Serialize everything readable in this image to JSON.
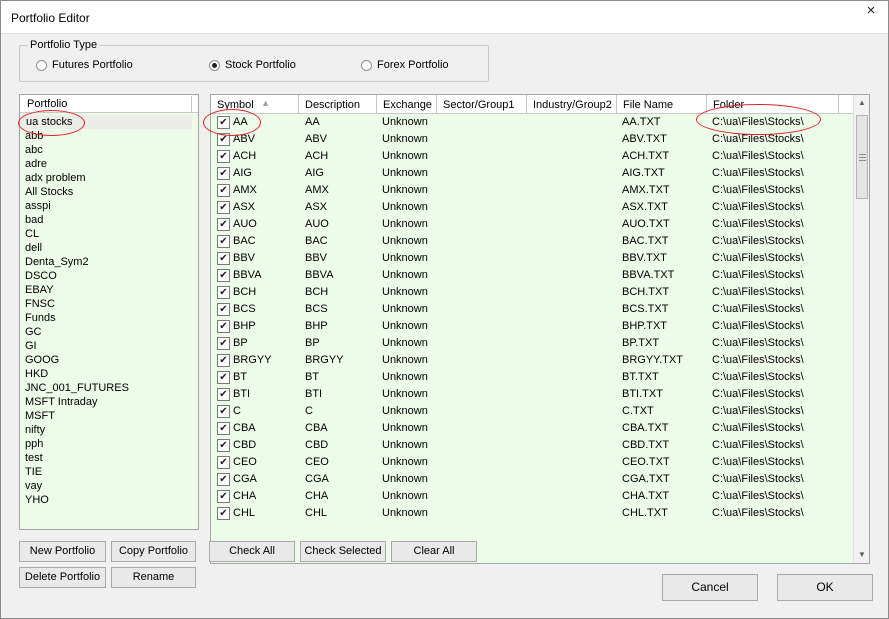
{
  "window": {
    "title": "Portfolio Editor",
    "close_glyph": "×"
  },
  "portfolio_type": {
    "label": "Portfolio Type",
    "options": [
      {
        "label": "Futures Portfolio",
        "checked": false
      },
      {
        "label": "Stock Portfolio",
        "checked": true
      },
      {
        "label": "Forex Portfolio",
        "checked": false
      }
    ]
  },
  "portfolio_list": {
    "header": "Portfolio",
    "items": [
      "ua stocks",
      "abb",
      "abc",
      "adre",
      "adx problem",
      "All Stocks",
      "asspi",
      "bad",
      "CL",
      "dell",
      "Denta_Sym2",
      "DSCO",
      "EBAY",
      "FNSC",
      "Funds",
      "GC",
      "GI",
      "GOOG",
      "HKD",
      "JNC_001_FUTURES",
      "MSFT Intraday",
      "MSFT",
      "nifty",
      "pph",
      "test",
      "TIE",
      "vay",
      "YHO"
    ],
    "selected_index": 0
  },
  "grid": {
    "columns": [
      "Symbol",
      "Description",
      "Exchange",
      "Sector/Group1",
      "Industry/Group2",
      "File Name",
      "Folder"
    ],
    "sort_glyph": "▲",
    "check_glyph": "✔",
    "rows": [
      {
        "symbol": "AA",
        "description": "AA",
        "exchange": "Unknown",
        "sector": "",
        "industry": "",
        "file": "AA.TXT",
        "folder": "C:\\ua\\Files\\Stocks\\"
      },
      {
        "symbol": "ABV",
        "description": "ABV",
        "exchange": "Unknown",
        "sector": "",
        "industry": "",
        "file": "ABV.TXT",
        "folder": "C:\\ua\\Files\\Stocks\\"
      },
      {
        "symbol": "ACH",
        "description": "ACH",
        "exchange": "Unknown",
        "sector": "",
        "industry": "",
        "file": "ACH.TXT",
        "folder": "C:\\ua\\Files\\Stocks\\"
      },
      {
        "symbol": "AIG",
        "description": "AIG",
        "exchange": "Unknown",
        "sector": "",
        "industry": "",
        "file": "AIG.TXT",
        "folder": "C:\\ua\\Files\\Stocks\\"
      },
      {
        "symbol": "AMX",
        "description": "AMX",
        "exchange": "Unknown",
        "sector": "",
        "industry": "",
        "file": "AMX.TXT",
        "folder": "C:\\ua\\Files\\Stocks\\"
      },
      {
        "symbol": "ASX",
        "description": "ASX",
        "exchange": "Unknown",
        "sector": "",
        "industry": "",
        "file": "ASX.TXT",
        "folder": "C:\\ua\\Files\\Stocks\\"
      },
      {
        "symbol": "AUO",
        "description": "AUO",
        "exchange": "Unknown",
        "sector": "",
        "industry": "",
        "file": "AUO.TXT",
        "folder": "C:\\ua\\Files\\Stocks\\"
      },
      {
        "symbol": "BAC",
        "description": "BAC",
        "exchange": "Unknown",
        "sector": "",
        "industry": "",
        "file": "BAC.TXT",
        "folder": "C:\\ua\\Files\\Stocks\\"
      },
      {
        "symbol": "BBV",
        "description": "BBV",
        "exchange": "Unknown",
        "sector": "",
        "industry": "",
        "file": "BBV.TXT",
        "folder": "C:\\ua\\Files\\Stocks\\"
      },
      {
        "symbol": "BBVA",
        "description": "BBVA",
        "exchange": "Unknown",
        "sector": "",
        "industry": "",
        "file": "BBVA.TXT",
        "folder": "C:\\ua\\Files\\Stocks\\"
      },
      {
        "symbol": "BCH",
        "description": "BCH",
        "exchange": "Unknown",
        "sector": "",
        "industry": "",
        "file": "BCH.TXT",
        "folder": "C:\\ua\\Files\\Stocks\\"
      },
      {
        "symbol": "BCS",
        "description": "BCS",
        "exchange": "Unknown",
        "sector": "",
        "industry": "",
        "file": "BCS.TXT",
        "folder": "C:\\ua\\Files\\Stocks\\"
      },
      {
        "symbol": "BHP",
        "description": "BHP",
        "exchange": "Unknown",
        "sector": "",
        "industry": "",
        "file": "BHP.TXT",
        "folder": "C:\\ua\\Files\\Stocks\\"
      },
      {
        "symbol": "BP",
        "description": "BP",
        "exchange": "Unknown",
        "sector": "",
        "industry": "",
        "file": "BP.TXT",
        "folder": "C:\\ua\\Files\\Stocks\\"
      },
      {
        "symbol": "BRGYY",
        "description": "BRGYY",
        "exchange": "Unknown",
        "sector": "",
        "industry": "",
        "file": "BRGYY.TXT",
        "folder": "C:\\ua\\Files\\Stocks\\"
      },
      {
        "symbol": "BT",
        "description": "BT",
        "exchange": "Unknown",
        "sector": "",
        "industry": "",
        "file": "BT.TXT",
        "folder": "C:\\ua\\Files\\Stocks\\"
      },
      {
        "symbol": "BTI",
        "description": "BTI",
        "exchange": "Unknown",
        "sector": "",
        "industry": "",
        "file": "BTI.TXT",
        "folder": "C:\\ua\\Files\\Stocks\\"
      },
      {
        "symbol": "C",
        "description": "C",
        "exchange": "Unknown",
        "sector": "",
        "industry": "",
        "file": "C.TXT",
        "folder": "C:\\ua\\Files\\Stocks\\"
      },
      {
        "symbol": "CBA",
        "description": "CBA",
        "exchange": "Unknown",
        "sector": "",
        "industry": "",
        "file": "CBA.TXT",
        "folder": "C:\\ua\\Files\\Stocks\\"
      },
      {
        "symbol": "CBD",
        "description": "CBD",
        "exchange": "Unknown",
        "sector": "",
        "industry": "",
        "file": "CBD.TXT",
        "folder": "C:\\ua\\Files\\Stocks\\"
      },
      {
        "symbol": "CEO",
        "description": "CEO",
        "exchange": "Unknown",
        "sector": "",
        "industry": "",
        "file": "CEO.TXT",
        "folder": "C:\\ua\\Files\\Stocks\\"
      },
      {
        "symbol": "CGA",
        "description": "CGA",
        "exchange": "Unknown",
        "sector": "",
        "industry": "",
        "file": "CGA.TXT",
        "folder": "C:\\ua\\Files\\Stocks\\"
      },
      {
        "symbol": "CHA",
        "description": "CHA",
        "exchange": "Unknown",
        "sector": "",
        "industry": "",
        "file": "CHA.TXT",
        "folder": "C:\\ua\\Files\\Stocks\\"
      },
      {
        "symbol": "CHL",
        "description": "CHL",
        "exchange": "Unknown",
        "sector": "",
        "industry": "",
        "file": "CHL.TXT",
        "folder": "C:\\ua\\Files\\Stocks\\"
      }
    ]
  },
  "scrollbar": {
    "up_glyph": "▲",
    "down_glyph": "▼"
  },
  "buttons": {
    "new_portfolio": "New Portfolio",
    "copy_portfolio": "Copy Portfolio",
    "delete_portfolio": "Delete Portfolio",
    "rename": "Rename",
    "check_all": "Check All",
    "check_selected": "Check Selected",
    "clear_all": "Clear All",
    "cancel": "Cancel",
    "ok": "OK"
  },
  "colors": {
    "list_bg": "#edfbe9",
    "annotation": "#e2242a"
  }
}
